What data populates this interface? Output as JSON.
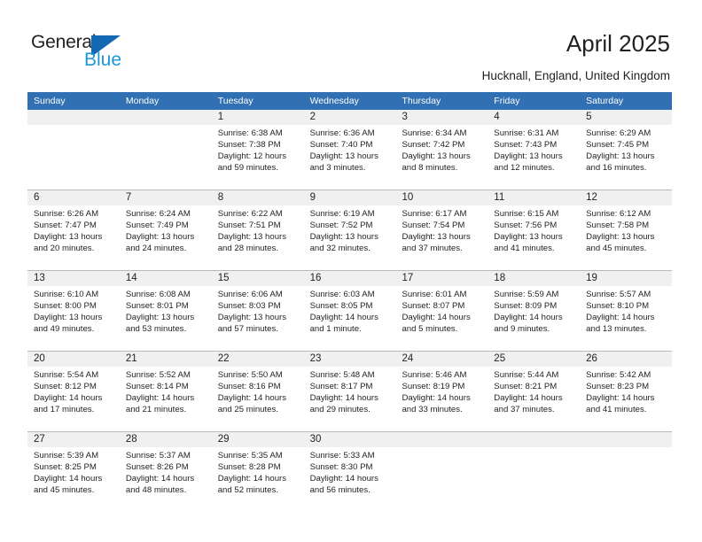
{
  "brand": {
    "name_part1": "General",
    "name_part2": "Blue",
    "flag_icon": "blue-flag-icon",
    "accent_color": "#1268b3",
    "secondary_color": "#2196d6"
  },
  "header": {
    "title": "April 2025",
    "subtitle": "Hucknall, England, United Kingdom"
  },
  "calendar": {
    "header_color": "#3070b3",
    "date_band_color": "#f0f0f0",
    "weekday_headers": [
      "Sunday",
      "Monday",
      "Tuesday",
      "Wednesday",
      "Thursday",
      "Friday",
      "Saturday"
    ],
    "weeks": [
      [
        {
          "day": "",
          "sunrise": "",
          "sunset": "",
          "daylight_line1": "",
          "daylight_line2": ""
        },
        {
          "day": "",
          "sunrise": "",
          "sunset": "",
          "daylight_line1": "",
          "daylight_line2": ""
        },
        {
          "day": "1",
          "sunrise": "Sunrise: 6:38 AM",
          "sunset": "Sunset: 7:38 PM",
          "daylight_line1": "Daylight: 12 hours",
          "daylight_line2": "and 59 minutes."
        },
        {
          "day": "2",
          "sunrise": "Sunrise: 6:36 AM",
          "sunset": "Sunset: 7:40 PM",
          "daylight_line1": "Daylight: 13 hours",
          "daylight_line2": "and 3 minutes."
        },
        {
          "day": "3",
          "sunrise": "Sunrise: 6:34 AM",
          "sunset": "Sunset: 7:42 PM",
          "daylight_line1": "Daylight: 13 hours",
          "daylight_line2": "and 8 minutes."
        },
        {
          "day": "4",
          "sunrise": "Sunrise: 6:31 AM",
          "sunset": "Sunset: 7:43 PM",
          "daylight_line1": "Daylight: 13 hours",
          "daylight_line2": "and 12 minutes."
        },
        {
          "day": "5",
          "sunrise": "Sunrise: 6:29 AM",
          "sunset": "Sunset: 7:45 PM",
          "daylight_line1": "Daylight: 13 hours",
          "daylight_line2": "and 16 minutes."
        }
      ],
      [
        {
          "day": "6",
          "sunrise": "Sunrise: 6:26 AM",
          "sunset": "Sunset: 7:47 PM",
          "daylight_line1": "Daylight: 13 hours",
          "daylight_line2": "and 20 minutes."
        },
        {
          "day": "7",
          "sunrise": "Sunrise: 6:24 AM",
          "sunset": "Sunset: 7:49 PM",
          "daylight_line1": "Daylight: 13 hours",
          "daylight_line2": "and 24 minutes."
        },
        {
          "day": "8",
          "sunrise": "Sunrise: 6:22 AM",
          "sunset": "Sunset: 7:51 PM",
          "daylight_line1": "Daylight: 13 hours",
          "daylight_line2": "and 28 minutes."
        },
        {
          "day": "9",
          "sunrise": "Sunrise: 6:19 AM",
          "sunset": "Sunset: 7:52 PM",
          "daylight_line1": "Daylight: 13 hours",
          "daylight_line2": "and 32 minutes."
        },
        {
          "day": "10",
          "sunrise": "Sunrise: 6:17 AM",
          "sunset": "Sunset: 7:54 PM",
          "daylight_line1": "Daylight: 13 hours",
          "daylight_line2": "and 37 minutes."
        },
        {
          "day": "11",
          "sunrise": "Sunrise: 6:15 AM",
          "sunset": "Sunset: 7:56 PM",
          "daylight_line1": "Daylight: 13 hours",
          "daylight_line2": "and 41 minutes."
        },
        {
          "day": "12",
          "sunrise": "Sunrise: 6:12 AM",
          "sunset": "Sunset: 7:58 PM",
          "daylight_line1": "Daylight: 13 hours",
          "daylight_line2": "and 45 minutes."
        }
      ],
      [
        {
          "day": "13",
          "sunrise": "Sunrise: 6:10 AM",
          "sunset": "Sunset: 8:00 PM",
          "daylight_line1": "Daylight: 13 hours",
          "daylight_line2": "and 49 minutes."
        },
        {
          "day": "14",
          "sunrise": "Sunrise: 6:08 AM",
          "sunset": "Sunset: 8:01 PM",
          "daylight_line1": "Daylight: 13 hours",
          "daylight_line2": "and 53 minutes."
        },
        {
          "day": "15",
          "sunrise": "Sunrise: 6:06 AM",
          "sunset": "Sunset: 8:03 PM",
          "daylight_line1": "Daylight: 13 hours",
          "daylight_line2": "and 57 minutes."
        },
        {
          "day": "16",
          "sunrise": "Sunrise: 6:03 AM",
          "sunset": "Sunset: 8:05 PM",
          "daylight_line1": "Daylight: 14 hours",
          "daylight_line2": "and 1 minute."
        },
        {
          "day": "17",
          "sunrise": "Sunrise: 6:01 AM",
          "sunset": "Sunset: 8:07 PM",
          "daylight_line1": "Daylight: 14 hours",
          "daylight_line2": "and 5 minutes."
        },
        {
          "day": "18",
          "sunrise": "Sunrise: 5:59 AM",
          "sunset": "Sunset: 8:09 PM",
          "daylight_line1": "Daylight: 14 hours",
          "daylight_line2": "and 9 minutes."
        },
        {
          "day": "19",
          "sunrise": "Sunrise: 5:57 AM",
          "sunset": "Sunset: 8:10 PM",
          "daylight_line1": "Daylight: 14 hours",
          "daylight_line2": "and 13 minutes."
        }
      ],
      [
        {
          "day": "20",
          "sunrise": "Sunrise: 5:54 AM",
          "sunset": "Sunset: 8:12 PM",
          "daylight_line1": "Daylight: 14 hours",
          "daylight_line2": "and 17 minutes."
        },
        {
          "day": "21",
          "sunrise": "Sunrise: 5:52 AM",
          "sunset": "Sunset: 8:14 PM",
          "daylight_line1": "Daylight: 14 hours",
          "daylight_line2": "and 21 minutes."
        },
        {
          "day": "22",
          "sunrise": "Sunrise: 5:50 AM",
          "sunset": "Sunset: 8:16 PM",
          "daylight_line1": "Daylight: 14 hours",
          "daylight_line2": "and 25 minutes."
        },
        {
          "day": "23",
          "sunrise": "Sunrise: 5:48 AM",
          "sunset": "Sunset: 8:17 PM",
          "daylight_line1": "Daylight: 14 hours",
          "daylight_line2": "and 29 minutes."
        },
        {
          "day": "24",
          "sunrise": "Sunrise: 5:46 AM",
          "sunset": "Sunset: 8:19 PM",
          "daylight_line1": "Daylight: 14 hours",
          "daylight_line2": "and 33 minutes."
        },
        {
          "day": "25",
          "sunrise": "Sunrise: 5:44 AM",
          "sunset": "Sunset: 8:21 PM",
          "daylight_line1": "Daylight: 14 hours",
          "daylight_line2": "and 37 minutes."
        },
        {
          "day": "26",
          "sunrise": "Sunrise: 5:42 AM",
          "sunset": "Sunset: 8:23 PM",
          "daylight_line1": "Daylight: 14 hours",
          "daylight_line2": "and 41 minutes."
        }
      ],
      [
        {
          "day": "27",
          "sunrise": "Sunrise: 5:39 AM",
          "sunset": "Sunset: 8:25 PM",
          "daylight_line1": "Daylight: 14 hours",
          "daylight_line2": "and 45 minutes."
        },
        {
          "day": "28",
          "sunrise": "Sunrise: 5:37 AM",
          "sunset": "Sunset: 8:26 PM",
          "daylight_line1": "Daylight: 14 hours",
          "daylight_line2": "and 48 minutes."
        },
        {
          "day": "29",
          "sunrise": "Sunrise: 5:35 AM",
          "sunset": "Sunset: 8:28 PM",
          "daylight_line1": "Daylight: 14 hours",
          "daylight_line2": "and 52 minutes."
        },
        {
          "day": "30",
          "sunrise": "Sunrise: 5:33 AM",
          "sunset": "Sunset: 8:30 PM",
          "daylight_line1": "Daylight: 14 hours",
          "daylight_line2": "and 56 minutes."
        },
        {
          "day": "",
          "sunrise": "",
          "sunset": "",
          "daylight_line1": "",
          "daylight_line2": ""
        },
        {
          "day": "",
          "sunrise": "",
          "sunset": "",
          "daylight_line1": "",
          "daylight_line2": ""
        },
        {
          "day": "",
          "sunrise": "",
          "sunset": "",
          "daylight_line1": "",
          "daylight_line2": ""
        }
      ]
    ]
  }
}
